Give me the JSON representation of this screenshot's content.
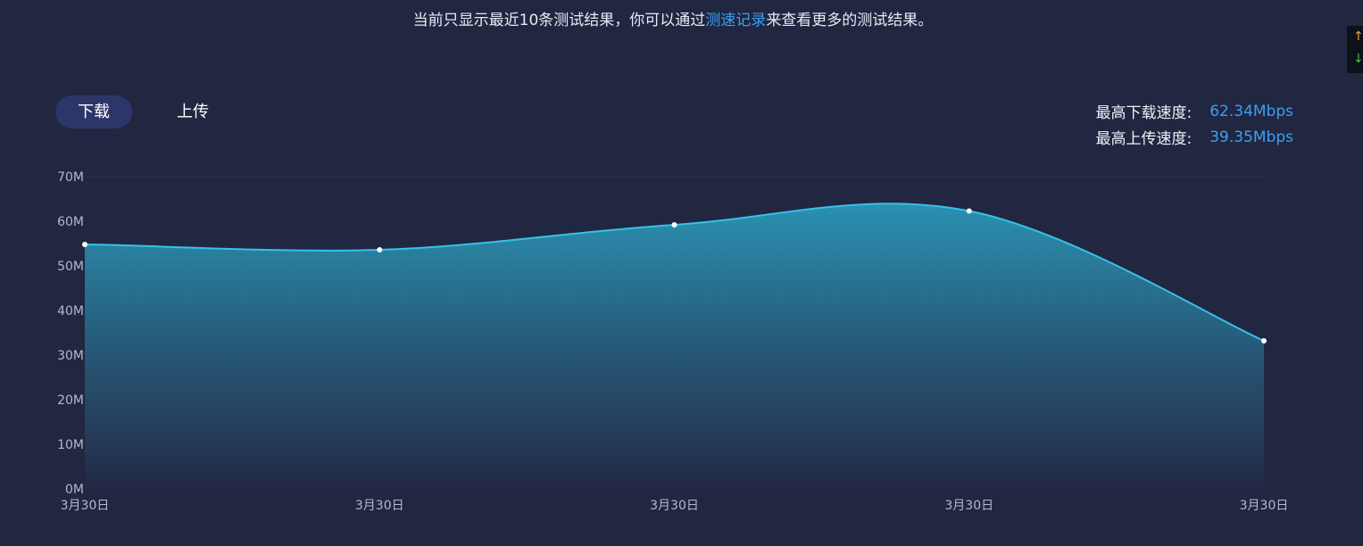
{
  "notice": {
    "prefix": "当前只显示最近10条测试结果，你可以通过",
    "link": "测速记录",
    "suffix": "来查看更多的测试结果。"
  },
  "tabs": {
    "download": "下载",
    "upload": "上传"
  },
  "stats": {
    "max_download_label": "最高下载速度:",
    "max_download_value": "62.34Mbps",
    "max_upload_label": "最高上传速度:",
    "max_upload_value": "39.35Mbps"
  },
  "colors": {
    "background": "#212641",
    "accent": "#3aa0f0",
    "line": "#35c2e8"
  },
  "chart_data": {
    "type": "area",
    "x": [
      "3月30日",
      "3月30日",
      "3月30日",
      "3月30日",
      "3月30日"
    ],
    "values": [
      54.8,
      53.6,
      59.2,
      62.3,
      33.2
    ],
    "y_ticks": [
      "0M",
      "10M",
      "20M",
      "30M",
      "40M",
      "50M",
      "60M",
      "70M"
    ],
    "ylim": [
      0,
      70
    ],
    "grid": false
  }
}
